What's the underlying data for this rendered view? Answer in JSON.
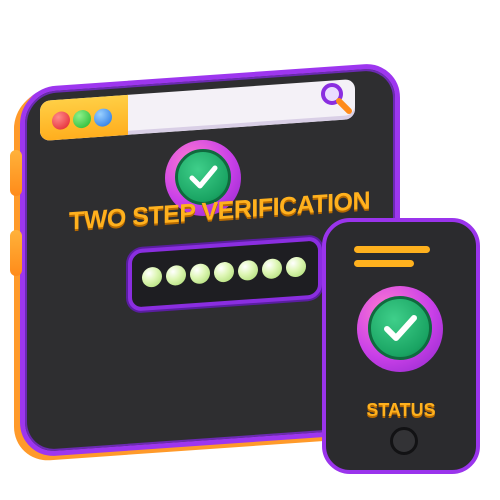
{
  "verification": {
    "title": "TWO STEP VERIFICATION",
    "code_length": 7
  },
  "phone": {
    "status_label": "STATUS"
  },
  "icons": {
    "browser_controls": [
      "red-dot-icon",
      "green-dot-icon",
      "blue-dot-icon"
    ],
    "search": "magnifier-icon",
    "checkmark": "checkmark-icon"
  },
  "colors": {
    "accent_orange": "#ffb11e",
    "frame_purple": "#9d36ef",
    "panel_dark": "#2e2e30",
    "check_green": "#1aa463"
  }
}
